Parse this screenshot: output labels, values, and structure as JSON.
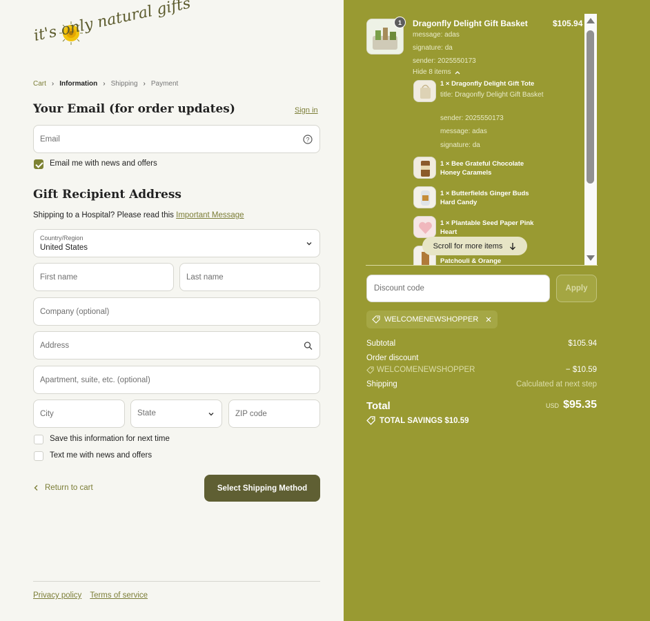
{
  "brand": {
    "logo_text": "it's only natural gifts"
  },
  "breadcrumb": {
    "cart": "Cart",
    "information": "Information",
    "shipping": "Shipping",
    "payment": "Payment"
  },
  "email_section": {
    "title": "Your Email (for order updates)",
    "sign_in": "Sign in",
    "email_placeholder": "Email",
    "newsletter_label": "Email me with news and offers",
    "newsletter_checked": true
  },
  "address_section": {
    "title": "Gift Recipient Address",
    "hospital_note": "Shipping to a Hospital? Please read this",
    "hospital_link": "Important Message",
    "country_label": "Country/Region",
    "country_value": "United States",
    "first_name_placeholder": "First name",
    "last_name_placeholder": "Last name",
    "company_placeholder": "Company (optional)",
    "address_placeholder": "Address",
    "apartment_placeholder": "Apartment, suite, etc. (optional)",
    "city_placeholder": "City",
    "state_placeholder": "State",
    "zip_placeholder": "ZIP code",
    "save_info_label": "Save this information for next time",
    "text_me_label": "Text me with news and offers"
  },
  "actions": {
    "return_label": "Return to cart",
    "submit_label": "Select Shipping Method"
  },
  "footer": {
    "privacy": "Privacy policy",
    "terms": "Terms of service"
  },
  "order": {
    "product_title": "Dragonfly Delight Gift Basket",
    "product_price": "$105.94",
    "quantity": "1",
    "message": "message: adas",
    "signature": "signature: da",
    "sender": "sender: 2025550173",
    "hide_items": "Hide 8 items",
    "items": [
      {
        "name": "1 × Dragonfly Delight Gift Tote",
        "title": "title: Dragonfly Delight Gift Basket",
        "sender": "sender: 2025550173",
        "message": "message: adas",
        "signature": "signature: da"
      },
      {
        "name": "1 × Bee Grateful Chocolate Honey Caramels"
      },
      {
        "name": "1 × Butterfields Ginger Buds Hard Candy"
      },
      {
        "name": "1 × Plantable Seed Paper Pink Heart"
      },
      {
        "name": "Patchouli & Orange"
      }
    ],
    "scroll_hint": "Scroll for more items"
  },
  "discount": {
    "placeholder": "Discount code",
    "apply": "Apply",
    "code": "WELCOMENEWSHOPPER"
  },
  "summary": {
    "subtotal_label": "Subtotal",
    "subtotal_value": "$105.94",
    "order_discount_label": "Order discount",
    "discount_code": "WELCOMENEWSHOPPER",
    "discount_value": "− $10.59",
    "shipping_label": "Shipping",
    "shipping_value": "Calculated at next step",
    "total_label": "Total",
    "currency": "USD",
    "total_value": "$95.35",
    "savings": "TOTAL SAVINGS $10.59"
  },
  "colors": {
    "accent": "#7b7d36",
    "panel": "#999a32",
    "button": "#5f5f33"
  }
}
